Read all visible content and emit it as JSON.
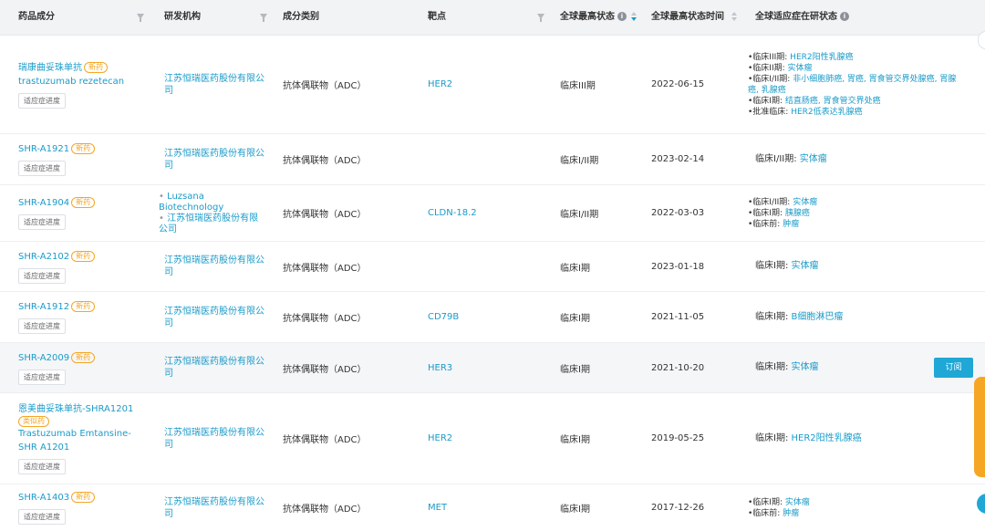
{
  "header": {
    "col_drug": "药品成分",
    "col_org": "研发机构",
    "col_type": "成分类别",
    "col_target": "靶点",
    "col_phase": "全球最高状态",
    "col_date": "全球最高状态时间",
    "col_ind": "全球适应症在研状态",
    "info_icon": "i"
  },
  "progress_label": "适应症进度",
  "subscribe_label": "订阅",
  "rows": [
    {
      "drug": "瑞康曲妥珠单抗",
      "badge": "新药",
      "drug_en": "trastuzumab rezetecan",
      "org": "江苏恒瑞医药股份有限公司",
      "type": "抗体偶联物（ADC）",
      "target": "HER2",
      "phase": "临床III期",
      "date": "2022-06-15",
      "ind": [
        {
          "label": "•临床III期: ",
          "links": "HER2阳性乳腺癌"
        },
        {
          "label": "•临床II期: ",
          "links": "实体瘤"
        },
        {
          "label": "•临床I/II期: ",
          "links": "非小细胞肺癌, 胃癌, 胃食管交界处腺癌, 胃腺"
        },
        {
          "label": "",
          "links": "癌, 乳腺癌"
        },
        {
          "label": "•临床I期: ",
          "links": "结直肠癌, 胃食管交界处癌"
        },
        {
          "label": "•批准临床: ",
          "links": "HER2低表达乳腺癌"
        }
      ]
    },
    {
      "drug": "SHR-A1921",
      "badge": "新药",
      "org": "江苏恒瑞医药股份有限公司",
      "type": "抗体偶联物（ADC）",
      "target": "",
      "phase": "临床I/II期",
      "date": "2023-02-14",
      "ind": [
        {
          "label": "临床I/II期: ",
          "links": "实体瘤"
        }
      ]
    },
    {
      "drug": "SHR-A1904",
      "badge": "新药",
      "org_list": [
        "Luzsana Biotechnology",
        "江苏恒瑞医药股份有限公司"
      ],
      "type": "抗体偶联物（ADC）",
      "target": "CLDN-18.2",
      "phase": "临床I/II期",
      "date": "2022-03-03",
      "ind": [
        {
          "label": "•临床I/II期: ",
          "links": "实体瘤"
        },
        {
          "label": "•临床I期: ",
          "links": "胰腺癌"
        },
        {
          "label": "•临床前: ",
          "links": "肿瘤"
        }
      ]
    },
    {
      "drug": "SHR-A2102",
      "badge": "新药",
      "org": "江苏恒瑞医药股份有限公司",
      "type": "抗体偶联物（ADC）",
      "target": "",
      "phase": "临床I期",
      "date": "2023-01-18",
      "ind": [
        {
          "label": "临床I期: ",
          "links": "实体瘤"
        }
      ]
    },
    {
      "drug": "SHR-A1912",
      "badge": "新药",
      "org": "江苏恒瑞医药股份有限公司",
      "type": "抗体偶联物（ADC）",
      "target": "CD79B",
      "phase": "临床I期",
      "date": "2021-11-05",
      "ind": [
        {
          "label": "临床I期: ",
          "links": "B细胞淋巴瘤"
        }
      ]
    },
    {
      "drug": "SHR-A2009",
      "badge": "新药",
      "org": "江苏恒瑞医药股份有限公司",
      "type": "抗体偶联物（ADC）",
      "target": "HER3",
      "phase": "临床I期",
      "date": "2021-10-20",
      "ind": [
        {
          "label": "临床I期: ",
          "links": "实体瘤"
        }
      ]
    },
    {
      "drug": "恩美曲妥珠单抗-SHRA1201",
      "badge": "类似药",
      "drug_en": "Trastuzumab Emtansine-SHR A1201",
      "org": "江苏恒瑞医药股份有限公司",
      "type": "抗体偶联物（ADC）",
      "target": "HER2",
      "phase": "临床I期",
      "date": "2019-05-25",
      "ind": [
        {
          "label": "临床I期: ",
          "links": "HER2阳性乳腺癌"
        }
      ]
    },
    {
      "drug": "SHR-A1403",
      "badge": "新药",
      "org": "江苏恒瑞医药股份有限公司",
      "type": "抗体偶联物（ADC）",
      "target": "MET",
      "phase": "临床I期",
      "date": "2017-12-26",
      "ind": [
        {
          "label": "•临床I期: ",
          "links": "实体瘤"
        },
        {
          "label": "•临床前: ",
          "links": "肿瘤"
        }
      ]
    }
  ],
  "colors": {
    "accent": "#1a9bc9",
    "badge": "#f5a623",
    "header_bg": "#f2f3f5"
  }
}
